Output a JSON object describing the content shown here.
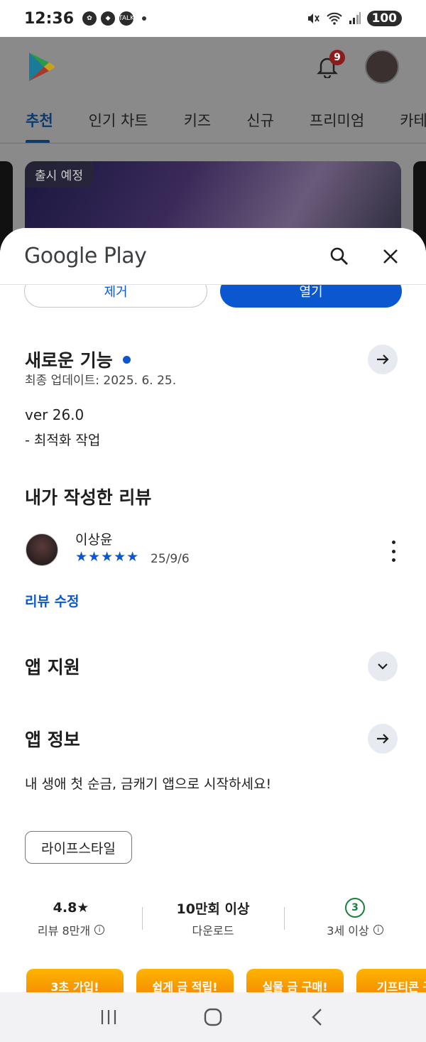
{
  "status_bar": {
    "time": "12:36",
    "left_icons": [
      "photo-icon",
      "app-icon",
      "talk-icon"
    ],
    "talk_label": "TALK",
    "battery": "100"
  },
  "background_app": {
    "notification_count": "9",
    "tabs": [
      "추천",
      "인기 차트",
      "키즈",
      "신규",
      "프리미엄",
      "카테고"
    ],
    "active_tab": "추천",
    "banner_chip": "출시 예정"
  },
  "sheet": {
    "title": "Google Play",
    "buttons": {
      "left": "제거",
      "right": "열기"
    },
    "whats_new": {
      "title": "새로운 기능",
      "date": "최종 업데이트: 2025. 6. 25.",
      "version": "ver 26.0",
      "notes": "- 최적화 작업"
    },
    "my_review": {
      "title": "내가 작성한 리뷰",
      "reviewer": "이상윤",
      "stars": "★★★★★",
      "rating": 5,
      "date": "25/9/6",
      "edit_label": "리뷰 수정"
    },
    "app_support": {
      "title": "앱 지원"
    },
    "app_info": {
      "title": "앱 정보",
      "description": "내 생애 첫 순금, 금캐기 앱으로 시작하세요!",
      "category": "라이프스타일"
    },
    "stats": [
      {
        "value": "4.8★",
        "label": "리뷰 8만개"
      },
      {
        "value": "10만회 이상",
        "label": "다운로드"
      },
      {
        "value": "3",
        "label": "3세 이상"
      }
    ],
    "promos": [
      "3초 가입!",
      "쉽게 금 적립!",
      "실물 금 구매!",
      "기프티콘 구"
    ]
  },
  "colors": {
    "accent": "#0b57d0",
    "age_badge": "#188038",
    "promo": "#f59a00"
  }
}
